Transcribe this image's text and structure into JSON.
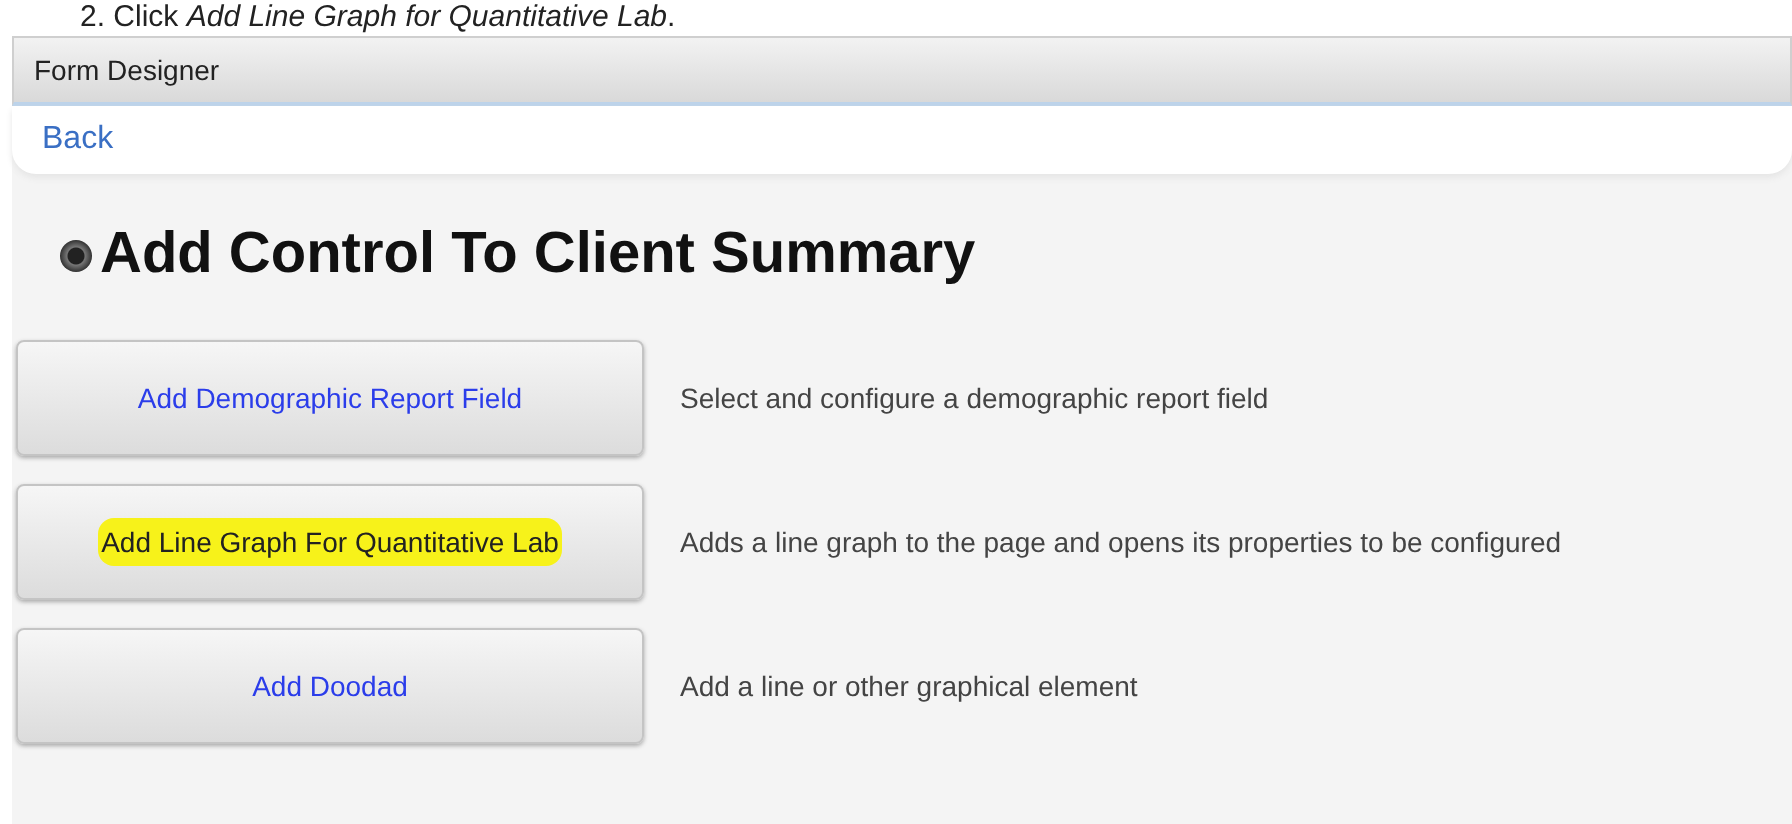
{
  "caption": "2.  Click *Add Line Graph for Quantitative Lab*.",
  "header": {
    "title": "Form Designer"
  },
  "nav": {
    "back_link": "Back"
  },
  "heading": "Add Control To Client Summary",
  "controls": [
    {
      "label": "Add Demographic Report Field",
      "description": "Select and configure a demographic report field",
      "highlighted": false
    },
    {
      "label": "Add Line Graph For Quantitative Lab",
      "description": "Adds a line graph to the page and opens its properties to be configured",
      "highlighted": true
    },
    {
      "label": "Add Doodad",
      "description": "Add a line or other graphical element",
      "highlighted": false
    }
  ]
}
